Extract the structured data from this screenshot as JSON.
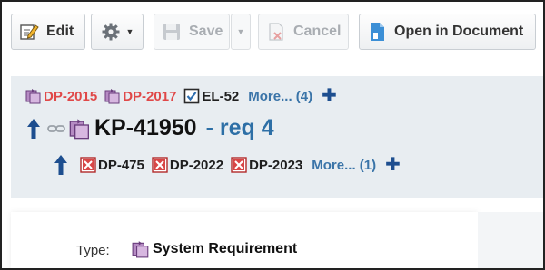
{
  "toolbar": {
    "edit_label": "Edit",
    "save_label": "Save",
    "cancel_label": "Cancel",
    "open_doc_label": "Open in Document",
    "icons": [
      "edit-icon",
      "gear-icon",
      "save-icon",
      "cancel-icon",
      "document-icon"
    ]
  },
  "relations": {
    "upstream": {
      "items": [
        {
          "id": "DP-2015",
          "icon": "system-requirement-icon",
          "color": "#e04848"
        },
        {
          "id": "DP-2017",
          "icon": "system-requirement-icon",
          "color": "#e04848"
        },
        {
          "id": "EL-52",
          "icon": "checkbox-icon",
          "color": "#1e1e1e"
        }
      ],
      "more_label": "More... (4)"
    },
    "current": {
      "id": "KP-41950",
      "title": "- req 4"
    },
    "downstream": {
      "items": [
        {
          "id": "DP-475",
          "icon": "test-case-icon"
        },
        {
          "id": "DP-2022",
          "icon": "test-case-icon"
        },
        {
          "id": "DP-2023",
          "icon": "test-case-icon"
        }
      ],
      "more_label": "More... (1)"
    }
  },
  "fields": {
    "type_label": "Type:",
    "type_value": "System Requirement"
  },
  "colors": {
    "accent_blue": "#2d6fa6",
    "link_blue": "#3a74a8",
    "plus_blue": "#1d4e8f",
    "relation_red": "#e04848",
    "panel_bg": "#e8edf1"
  }
}
